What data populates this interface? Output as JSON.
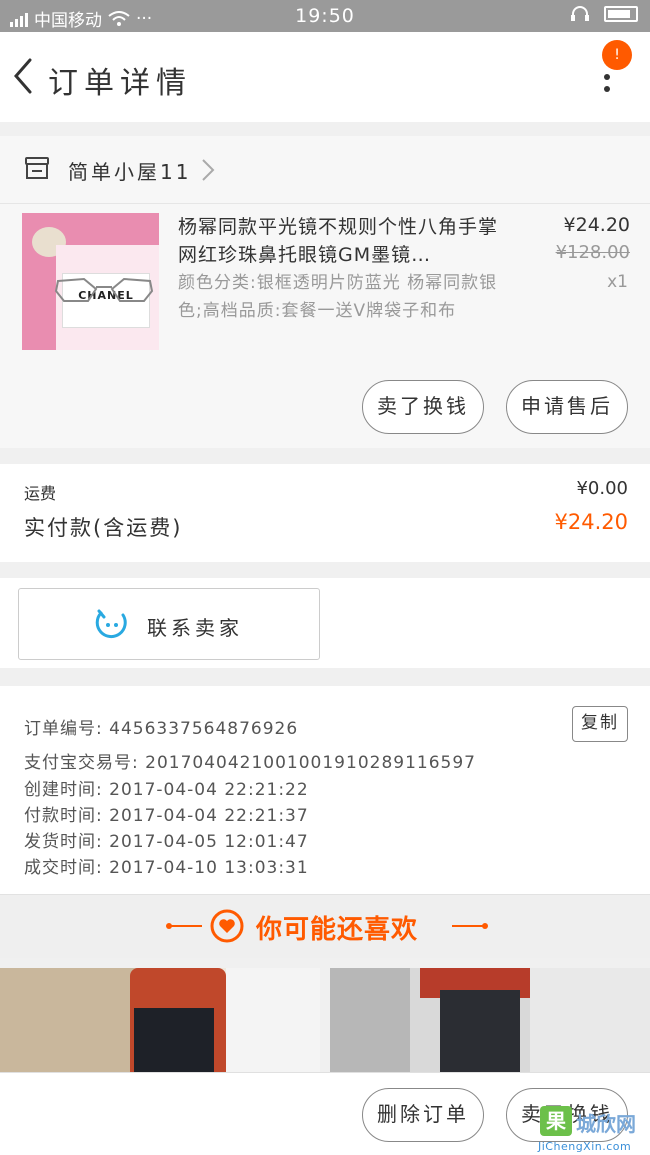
{
  "status_bar": {
    "carrier": "中国移动",
    "dots": "···",
    "time": "19:50"
  },
  "navbar": {
    "title": "订单详情",
    "badge": "!"
  },
  "store": {
    "name": "简单小屋11"
  },
  "product": {
    "image_brand": "CHANEL",
    "title": "杨幂同款平光镜不规则个性八角手掌网红珍珠鼻托眼镜GM墨镜…",
    "spec": "颜色分类:银框透明片防蓝光 杨幂同款银色;高档品质:套餐一送V牌袋子和布",
    "price": "¥24.20",
    "old_price": "¥128.00",
    "quantity": "x1"
  },
  "item_actions": {
    "sell_label": "卖了换钱",
    "after_sales_label": "申请售后"
  },
  "fees": {
    "shipping_label": "运费",
    "shipping_value": "¥0.00",
    "paid_label": "实付款(含运费)",
    "paid_value": "¥24.20"
  },
  "contact": {
    "label": "联系卖家"
  },
  "order_info": {
    "order_no": "订单编号: 4456337564876926",
    "copy_label": "复制",
    "alipay_no": "支付宝交易号: 2017040421001001910289116597",
    "created": "创建时间: 2017-04-04 22:21:22",
    "paid": "付款时间: 2017-04-04 22:21:37",
    "shipped": "发货时间: 2017-04-05 12:01:47",
    "completed": "成交时间: 2017-04-10 13:03:31"
  },
  "recommend": {
    "title": "你可能还喜欢"
  },
  "bottom": {
    "delete_label": "删除订单",
    "sell_label": "卖了换钱"
  },
  "watermark": {
    "logo": "果",
    "text": "城欣网",
    "url": "JiChengXin.com"
  },
  "colors": {
    "accent": "#ff5a00",
    "status_bar": "#9a9a9a",
    "chat_icon": "#29a9e1"
  }
}
